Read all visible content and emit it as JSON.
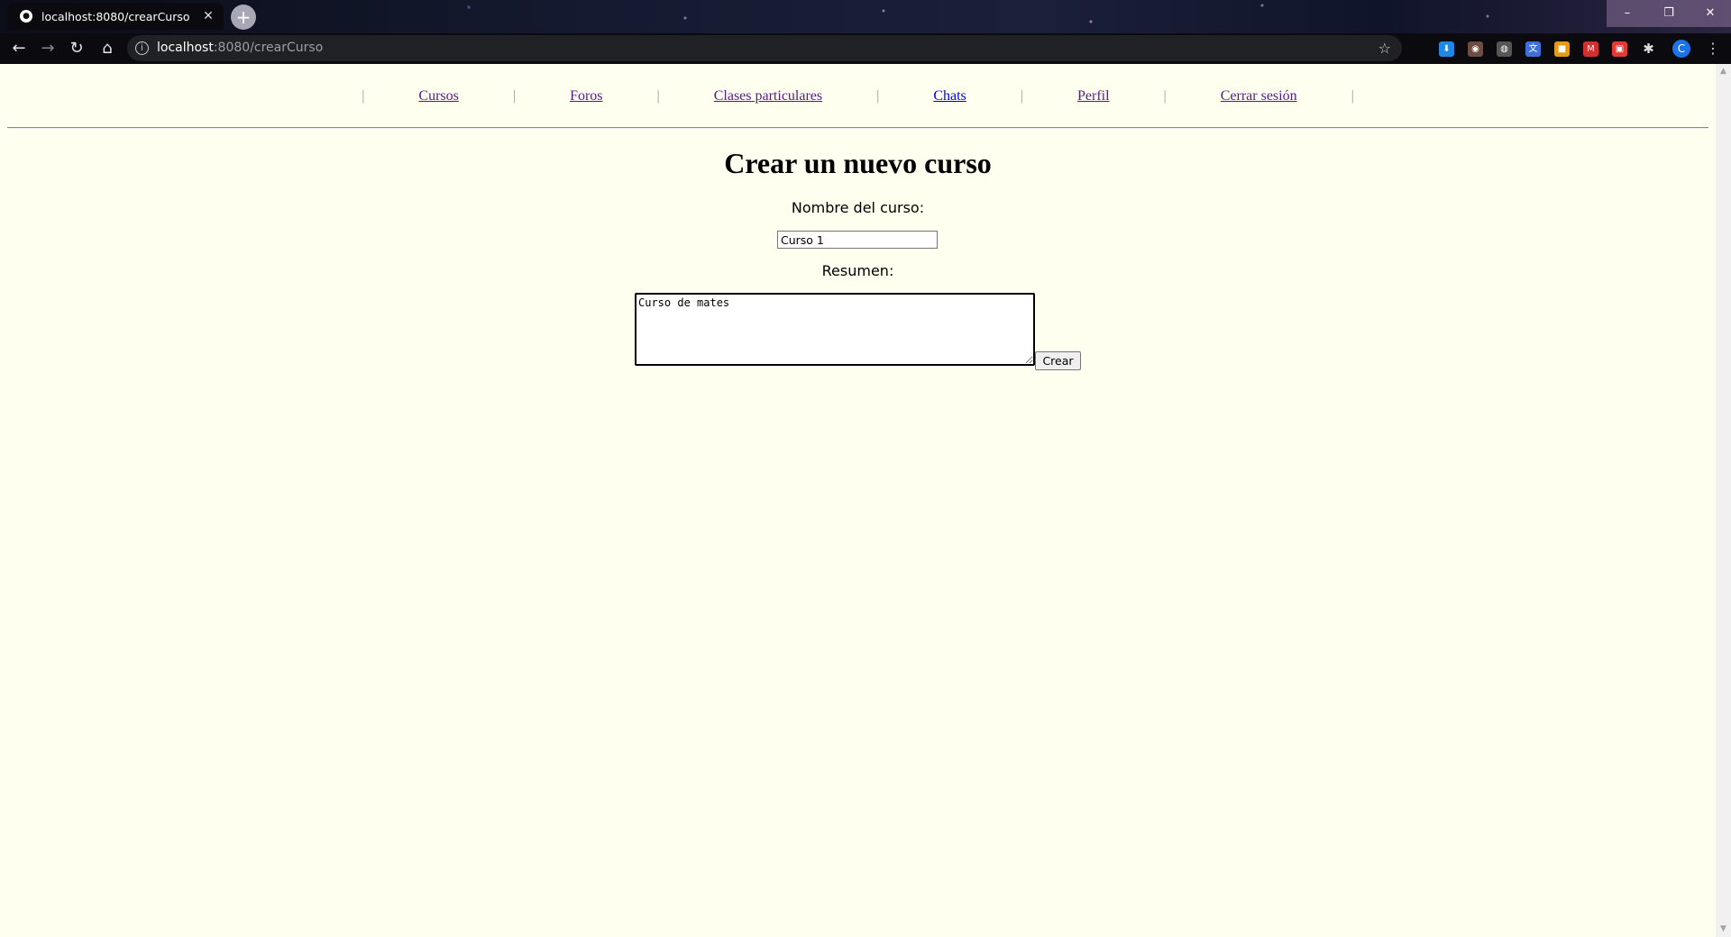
{
  "browser": {
    "tab_title": "localhost:8080/crearCurso",
    "url_host": "localhost",
    "url_path": ":8080/crearCurso",
    "new_tab_symbol": "+",
    "close_symbol": "✕",
    "profile_initial": "C"
  },
  "nav": {
    "items": [
      {
        "label": "Cursos",
        "visited": true
      },
      {
        "label": "Foros",
        "visited": true
      },
      {
        "label": "Clases particulares",
        "visited": true
      },
      {
        "label": "Chats",
        "visited": false
      },
      {
        "label": "Perfil",
        "visited": true
      },
      {
        "label": "Cerrar sesión",
        "visited": true
      }
    ],
    "separator": "|"
  },
  "form": {
    "heading": "Crear un nuevo curso",
    "nombre_label": "Nombre del curso:",
    "nombre_value": "Curso 1",
    "resumen_label": "Resumen:",
    "resumen_value": "Curso de mates",
    "submit_label": "Crear"
  },
  "colors": {
    "page_background": "#fffff0",
    "visited_link": "#551a8b",
    "unvisited_link": "#0000ee"
  }
}
